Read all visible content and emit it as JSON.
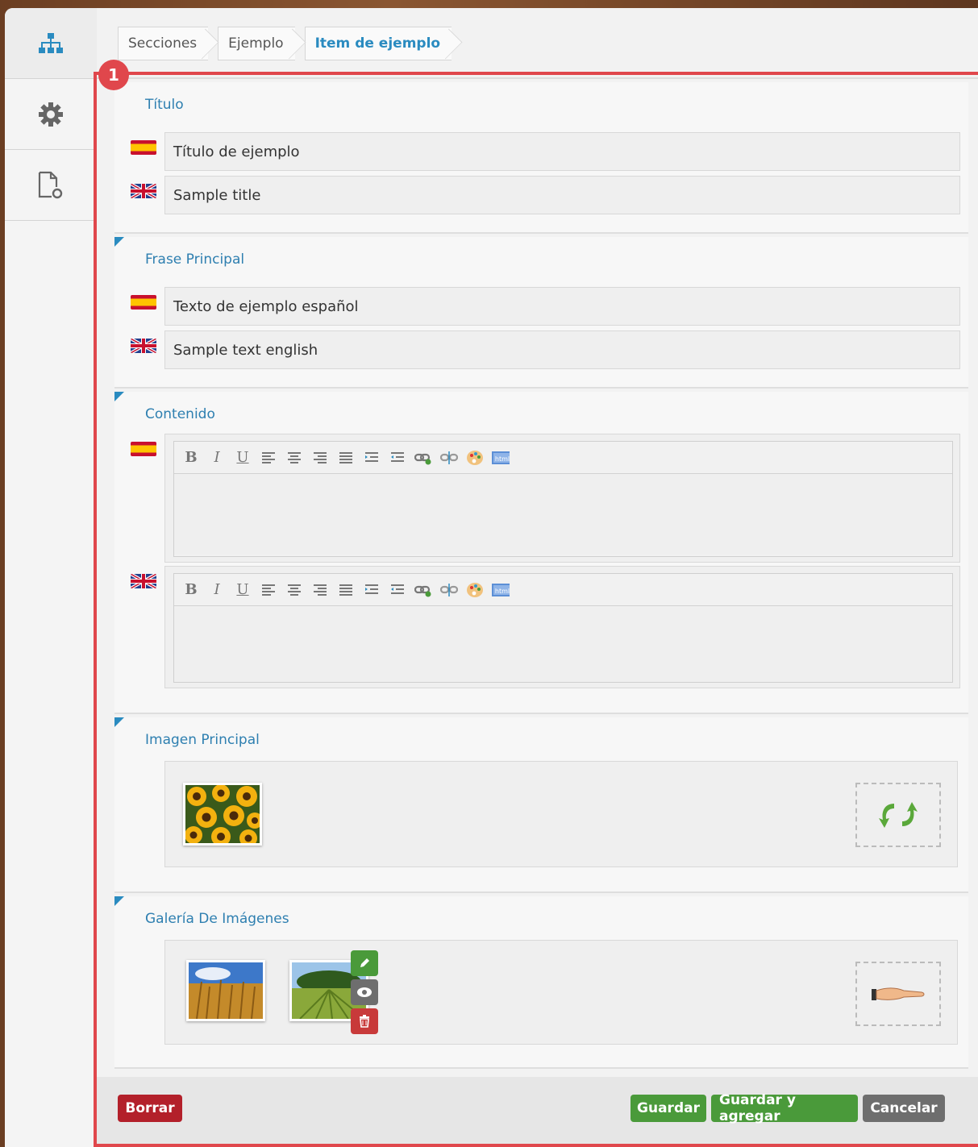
{
  "breadcrumb": {
    "items": [
      "Secciones",
      "Ejemplo",
      "Item de ejemplo"
    ]
  },
  "sidebar": {
    "items": [
      {
        "name": "sitemap-icon"
      },
      {
        "name": "gear-icon"
      },
      {
        "name": "document-settings-icon"
      }
    ]
  },
  "badge": "1",
  "sections": {
    "titulo": {
      "title": "Título",
      "es_value": "Título de ejemplo",
      "en_value": "Sample title"
    },
    "frase": {
      "title": "Frase Principal",
      "es_value": "Texto de ejemplo español",
      "en_value": "Sample text english"
    },
    "contenido": {
      "title": "Contenido",
      "toolbar": {
        "bold": "B",
        "italic": "I",
        "underline": "U"
      }
    },
    "imagen": {
      "title": "Imagen Principal"
    },
    "galeria": {
      "title": "Galería De Imágenes"
    }
  },
  "footer": {
    "delete_label": "Borrar",
    "save_label": "Guardar",
    "save_add_label": "Guardar y agregar",
    "cancel_label": "Cancelar"
  },
  "colors": {
    "accent": "#2a8bc0",
    "highlight": "#e0474c",
    "danger": "#b3202a",
    "success": "#4a9a3a",
    "neutral": "#6e6e6e"
  }
}
